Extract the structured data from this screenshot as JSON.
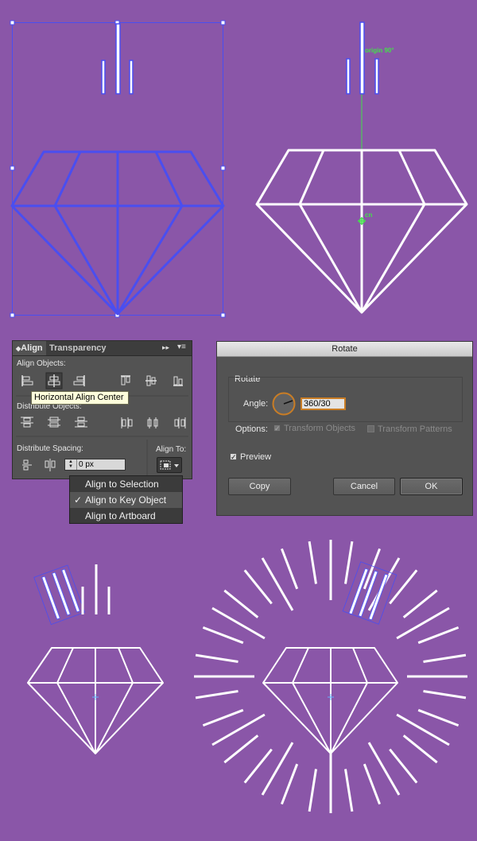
{
  "align_panel": {
    "tabs": [
      "Align",
      "Transparency"
    ],
    "active_tab": "Align",
    "align_objects_label": "Align Objects:",
    "distribute_objects_label": "Distribute Objects:",
    "distribute_spacing_label": "Distribute Spacing:",
    "align_to_label": "Align To:",
    "spacing_value": "0 px",
    "tooltip": "Horizontal Align Center",
    "menu_icon": "panel-menu-icon",
    "collapse_icon": "double-chevron-icon"
  },
  "align_to_menu": {
    "items": [
      {
        "label": "Align to Selection",
        "checked": false
      },
      {
        "label": "Align to Key Object",
        "checked": true
      },
      {
        "label": "Align to Artboard",
        "checked": false
      }
    ],
    "check_glyph": "✓"
  },
  "rotate_dialog": {
    "title": "Rotate",
    "group_label": "Rotate",
    "angle_label": "Angle:",
    "angle_value": "360/30",
    "options_label": "Options:",
    "transform_objects": "Transform Objects",
    "transform_patterns": "Transform Patterns",
    "preview_label": "Preview",
    "preview_checked": true,
    "copy_button": "Copy",
    "cancel_button": "Cancel",
    "ok_button": "OK"
  },
  "canvas": {
    "rotate_origin_label": "origin 90°",
    "center_label": "cn"
  },
  "colors": {
    "background": "#8a56a8",
    "selection": "#4a4ef0",
    "smart_guide": "#43e04a",
    "shape_stroke": "#ffffff"
  }
}
